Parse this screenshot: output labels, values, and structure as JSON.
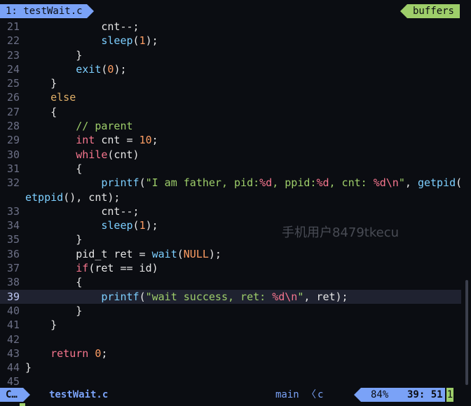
{
  "tabline": {
    "active_tab": "1: testWait.c",
    "right_label": "buffers"
  },
  "code_lines": [
    {
      "n": "21",
      "t": [
        [
          "            ",
          ""
        ],
        [
          "cnt--;",
          ""
        ]
      ]
    },
    {
      "n": "22",
      "t": [
        [
          "            ",
          ""
        ],
        [
          "sleep",
          "fn"
        ],
        [
          "(",
          ""
        ],
        [
          "1",
          "num"
        ],
        [
          ");",
          ""
        ]
      ]
    },
    {
      "n": "23",
      "t": [
        [
          "        }",
          ""
        ]
      ]
    },
    {
      "n": "24",
      "t": [
        [
          "        ",
          ""
        ],
        [
          "exit",
          "fn"
        ],
        [
          "(",
          ""
        ],
        [
          "0",
          "num"
        ],
        [
          ");",
          ""
        ]
      ]
    },
    {
      "n": "25",
      "t": [
        [
          "    }",
          ""
        ]
      ]
    },
    {
      "n": "26",
      "t": [
        [
          "    ",
          ""
        ],
        [
          "else",
          "kw"
        ]
      ]
    },
    {
      "n": "27",
      "t": [
        [
          "    {",
          ""
        ]
      ]
    },
    {
      "n": "28",
      "t": [
        [
          "        ",
          ""
        ],
        [
          "// parent",
          "cmt"
        ]
      ]
    },
    {
      "n": "29",
      "t": [
        [
          "        ",
          ""
        ],
        [
          "int",
          "kw2"
        ],
        [
          " cnt = ",
          ""
        ],
        [
          "10",
          "num"
        ],
        [
          ";",
          ""
        ]
      ]
    },
    {
      "n": "30",
      "t": [
        [
          "        ",
          ""
        ],
        [
          "while",
          "kw2"
        ],
        [
          "(cnt)",
          ""
        ]
      ]
    },
    {
      "n": "31",
      "t": [
        [
          "        {",
          ""
        ]
      ]
    },
    {
      "n": "32",
      "t": [
        [
          "            ",
          ""
        ],
        [
          "printf",
          "fn"
        ],
        [
          "(",
          ""
        ],
        [
          "\"I am father, pid:",
          "str"
        ],
        [
          "%d",
          "esc"
        ],
        [
          ", ppid:",
          "str"
        ],
        [
          "%d",
          "esc"
        ],
        [
          ", cnt: ",
          "str"
        ],
        [
          "%d\\n",
          "esc"
        ],
        [
          "\"",
          "str"
        ],
        [
          ", ",
          ""
        ],
        [
          "getpid",
          "fn"
        ],
        [
          "(), ",
          ""
        ],
        [
          "g",
          "fn"
        ]
      ]
    },
    {
      "n": "",
      "wrap": true,
      "t": [
        [
          "etppid",
          "fn"
        ],
        [
          "(), cnt);",
          ""
        ]
      ]
    },
    {
      "n": "33",
      "t": [
        [
          "            cnt--;",
          ""
        ]
      ]
    },
    {
      "n": "34",
      "t": [
        [
          "            ",
          ""
        ],
        [
          "sleep",
          "fn"
        ],
        [
          "(",
          ""
        ],
        [
          "1",
          "num"
        ],
        [
          ");",
          ""
        ]
      ]
    },
    {
      "n": "35",
      "t": [
        [
          "        }",
          ""
        ]
      ]
    },
    {
      "n": "36",
      "t": [
        [
          "        pid_t ret = ",
          ""
        ],
        [
          "wait",
          "fn"
        ],
        [
          "(",
          ""
        ],
        [
          "NULL",
          "num"
        ],
        [
          ");",
          ""
        ]
      ]
    },
    {
      "n": "37",
      "t": [
        [
          "        ",
          ""
        ],
        [
          "if",
          "kw2"
        ],
        [
          "(ret == id)",
          ""
        ]
      ]
    },
    {
      "n": "38",
      "t": [
        [
          "        {",
          ""
        ]
      ]
    },
    {
      "n": "39",
      "cur": true,
      "t": [
        [
          "            ",
          ""
        ],
        [
          "printf",
          "fn"
        ],
        [
          "(",
          ""
        ],
        [
          "\"wait success, ret: ",
          "str"
        ],
        [
          "%d\\n",
          "esc"
        ],
        [
          "\"",
          "str"
        ],
        [
          ", ret);",
          ""
        ]
      ]
    },
    {
      "n": "40",
      "t": [
        [
          "        }",
          ""
        ]
      ]
    },
    {
      "n": "41",
      "t": [
        [
          "    }",
          ""
        ]
      ]
    },
    {
      "n": "42",
      "t": [
        [
          "",
          ""
        ]
      ]
    },
    {
      "n": "43",
      "t": [
        [
          "    ",
          ""
        ],
        [
          "return",
          "kw2"
        ],
        [
          " ",
          ""
        ],
        [
          "0",
          "num"
        ],
        [
          ";",
          ""
        ]
      ]
    },
    {
      "n": "44",
      "t": [
        [
          "}",
          ""
        ]
      ]
    },
    {
      "n": "45",
      "t": [
        [
          "",
          ""
        ]
      ]
    }
  ],
  "watermark": "手机用户8479tkecu",
  "statusline": {
    "mode": "C…",
    "filename": "testWait.c",
    "branch": "main",
    "separator": "〈",
    "filetype": "c",
    "percent": "84%",
    "line_col": "39: 51",
    "cursor_char": "1"
  },
  "colors": {
    "background": "#0b0d12",
    "accent_blue": "#7aa2f7",
    "accent_green": "#9ece6a",
    "keyword": "#e0af68",
    "keyword_red": "#f7768e",
    "function": "#7dcfff",
    "number": "#ff9e64"
  }
}
